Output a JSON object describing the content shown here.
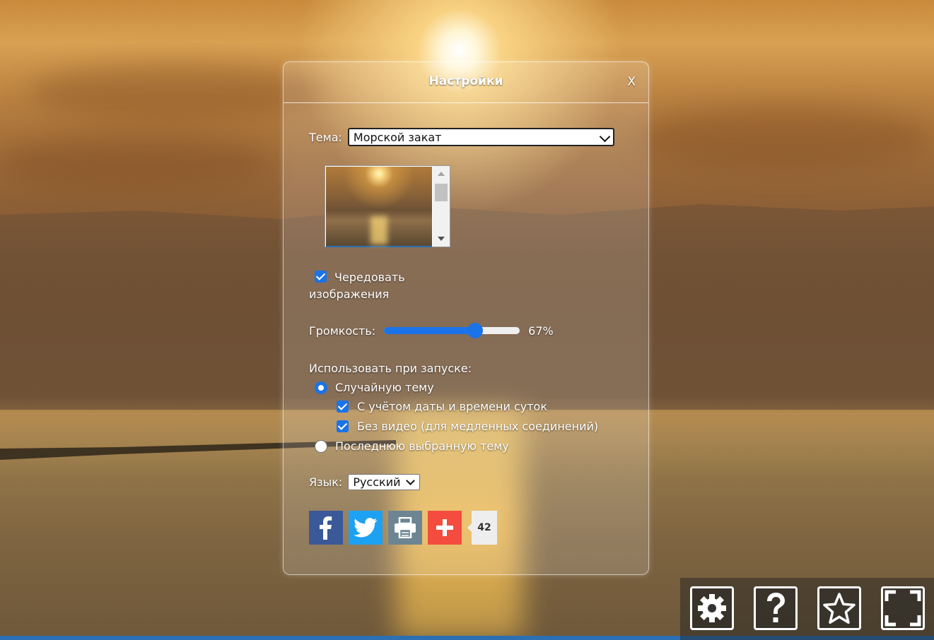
{
  "dialog": {
    "title": "Настройки",
    "close_label": "X"
  },
  "theme": {
    "label": "Тема:",
    "selected": "Морской закат"
  },
  "rotate": {
    "label": "Чередовать изображения",
    "checked": true
  },
  "volume": {
    "label": "Громкость:",
    "value": 67,
    "value_text": "67%"
  },
  "startup": {
    "label": "Использовать при запуске:",
    "random_theme": "Случайную тему",
    "date_time": "С учётом даты и времени суток",
    "no_video": "Без видео (для медленных соединений)",
    "last_theme": "Последнюю выбранную тему"
  },
  "language": {
    "label": "Язык:",
    "selected": "Русский"
  },
  "share": {
    "count": "42"
  },
  "icons": {
    "facebook": "facebook-icon",
    "twitter": "twitter-icon",
    "print": "print-icon",
    "plus": "plus-icon",
    "settings": "gear-icon",
    "help": "question-icon",
    "favorite": "star-icon",
    "fullscreen": "fullscreen-icon"
  },
  "colors": {
    "accent": "#1a73e8",
    "facebook": "#3b5998",
    "twitter": "#1da1f2",
    "print": "#6d8592",
    "plus": "#f44c3f"
  }
}
